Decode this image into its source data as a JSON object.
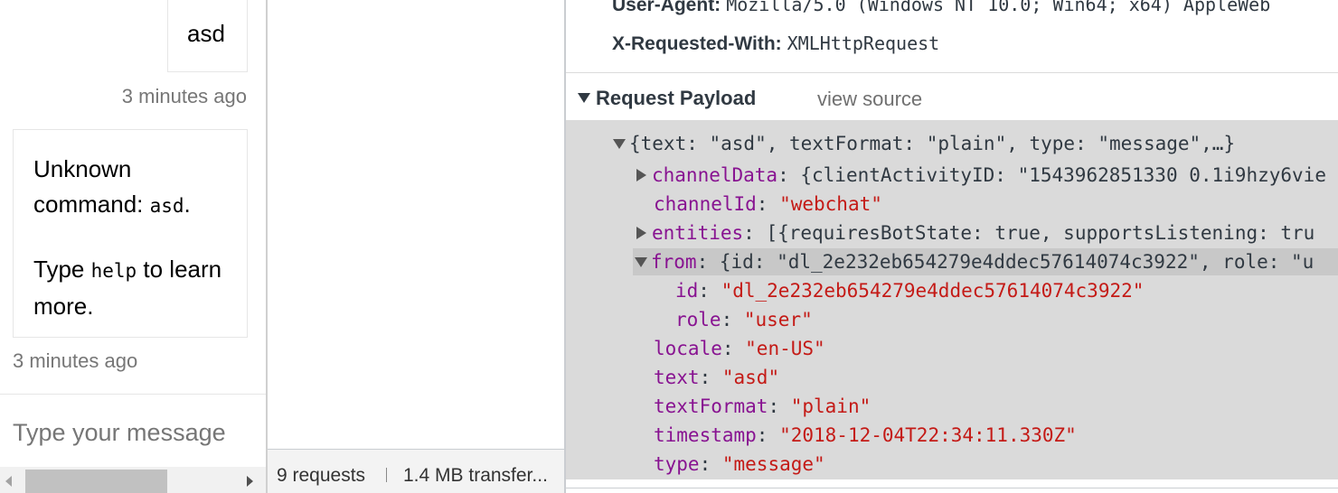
{
  "chat": {
    "user_message": "asd",
    "user_timestamp": "3 minutes ago",
    "bot_line1_prefix": "Unknown command: ",
    "bot_line1_code": "asd",
    "bot_line1_suffix": ".",
    "bot_line2_prefix": "Type ",
    "bot_line2_code": "help",
    "bot_line2_suffix": " to learn more.",
    "bot_timestamp": "3 minutes ago",
    "input_placeholder": "Type your message"
  },
  "network": {
    "status_requests": "9 requests",
    "status_transfer": "1.4 MB transfer..."
  },
  "headers": {
    "user_agent_key": "User-Agent:",
    "user_agent_value": "Mozilla/5.0 (Windows NT 10.0; Win64; x64) AppleWeb",
    "xrw_key": "X-Requested-With:",
    "xrw_value": "XMLHttpRequest"
  },
  "payload": {
    "section_title": "Request Payload",
    "view_source": "view source",
    "summary": "{text: \"asd\", textFormat: \"plain\", type: \"message\",…}",
    "channelData_key": "channelData",
    "channelData_preview": "{clientActivityID: \"1543962851330 0.1i9hzy6vie",
    "channelId_key": "channelId",
    "channelId_val": "\"webchat\"",
    "entities_key": "entities",
    "entities_preview": "[{requiresBotState: true, supportsListening: tru",
    "from_key": "from",
    "from_preview": "{id: \"dl_2e232eb654279e4ddec57614074c3922\", role: \"u",
    "from_id_key": "id",
    "from_id_val": "\"dl_2e232eb654279e4ddec57614074c3922\"",
    "from_role_key": "role",
    "from_role_val": "\"user\"",
    "locale_key": "locale",
    "locale_val": "\"en-US\"",
    "text_key": "text",
    "text_val": "\"asd\"",
    "textFormat_key": "textFormat",
    "textFormat_val": "\"plain\"",
    "timestamp_key": "timestamp",
    "timestamp_val": "\"2018-12-04T22:34:11.330Z\"",
    "type_key": "type",
    "type_val": "\"message\""
  },
  "icons": [
    "expand-triangle-icon",
    "collapse-triangle-icon",
    "scroll-left-arrow-icon",
    "scroll-right-arrow-icon"
  ]
}
